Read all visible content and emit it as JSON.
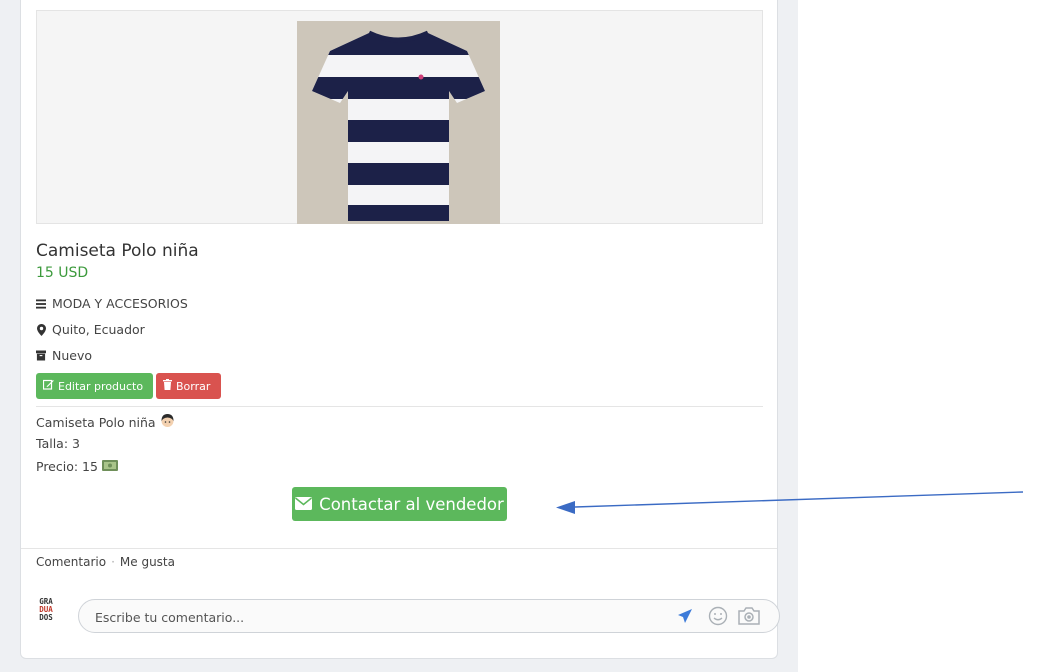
{
  "product": {
    "title": "Camiseta Polo niña",
    "price": "15 USD",
    "category": "MODA Y ACCESORIOS",
    "location": "Quito, Ecuador",
    "condition": "Nuevo"
  },
  "actions": {
    "edit_label": "Editar producto",
    "delete_label": "Borrar"
  },
  "description": {
    "line1": "Camiseta Polo niña",
    "line2": "Talla: 3",
    "line3": "Precio: 15"
  },
  "contact": {
    "label": "Contactar al vendedor"
  },
  "footer": {
    "comment_link": "Comentario",
    "separator": "·",
    "like_link": "Me gusta"
  },
  "comment": {
    "placeholder": "Escribe tu comentario..."
  },
  "avatar": {
    "lines": [
      "GRA",
      "DUA",
      "DOS"
    ]
  },
  "colors": {
    "accent_green": "#5cb85c",
    "danger_red": "#d9534f",
    "price_green": "#3c9a3c",
    "annotation_arrow": "#3b6bc4",
    "send_icon": "#3d7bd9"
  },
  "icons": [
    "bars-icon",
    "map-marker-icon",
    "archive-icon",
    "edit-icon",
    "trash-icon",
    "envelope-icon",
    "send-icon",
    "smiley-icon",
    "camera-icon"
  ]
}
